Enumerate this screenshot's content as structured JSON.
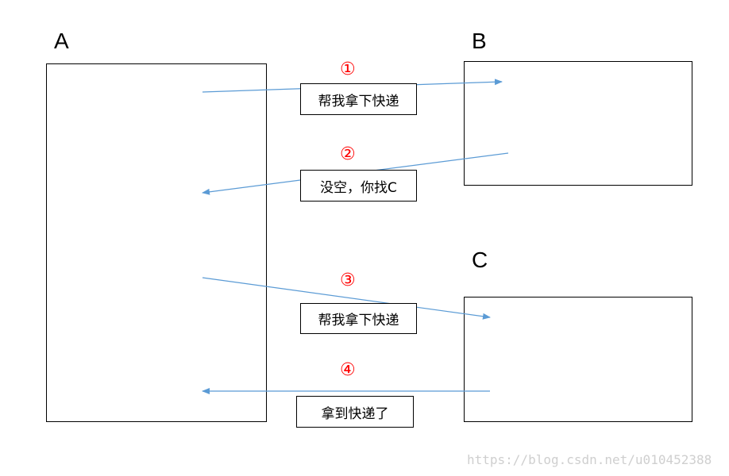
{
  "nodes": {
    "a": "A",
    "b": "B",
    "c": "C"
  },
  "steps": [
    {
      "num": "①",
      "message": "帮我拿下快递"
    },
    {
      "num": "②",
      "message": "没空，你找C"
    },
    {
      "num": "③",
      "message": "帮我拿下快递"
    },
    {
      "num": "④",
      "message": "拿到快递了"
    }
  ],
  "watermark": "https://blog.csdn.net/u010452388",
  "colors": {
    "arrow": "#5b9bd5",
    "step_number": "#ff0000",
    "border": "#000000"
  }
}
